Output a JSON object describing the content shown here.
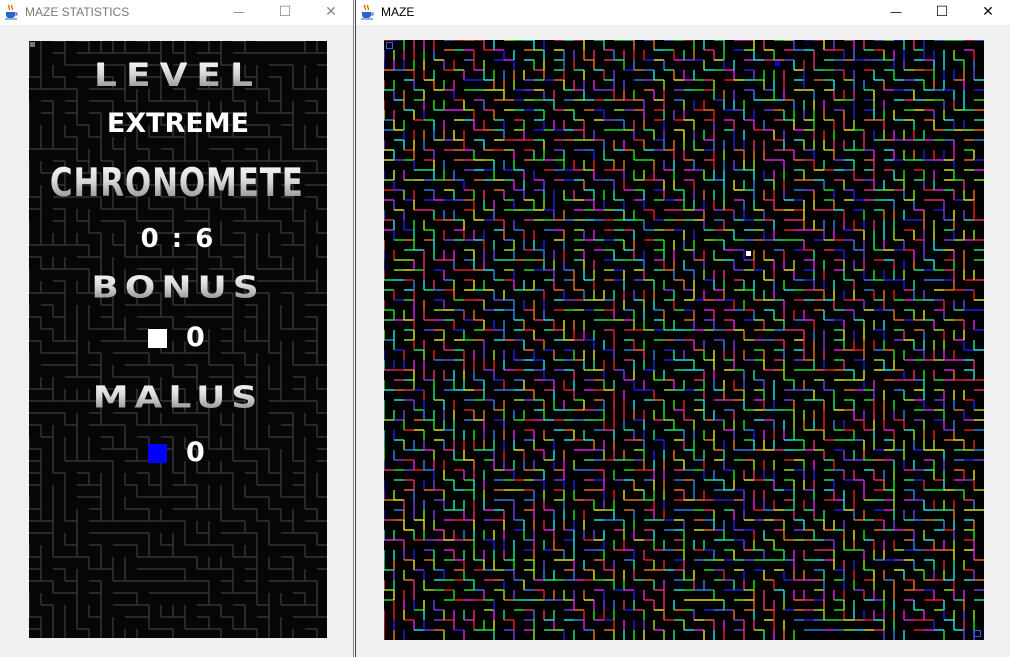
{
  "windows": [
    {
      "title": "MAZE STATISTICS",
      "controls": {
        "minimize": "—",
        "maximize": "☐",
        "close": "✕"
      }
    },
    {
      "title": "MAZE",
      "controls": {
        "minimize": "—",
        "maximize": "☐",
        "close": "✕"
      }
    }
  ],
  "stats": {
    "level_heading": "LEVEL",
    "level_value": "EXTREME",
    "chrono_heading": "CHRONOMETER",
    "chrono_value": "0 : 6",
    "bonus_heading": "BONUS",
    "bonus_count": "0",
    "malus_heading": "MALUS",
    "malus_count": "0"
  },
  "icons": {
    "app": "java-cup-icon",
    "bonus": "white-square-icon",
    "malus": "blue-square-icon"
  },
  "colors": {
    "bonus": "#ffffff",
    "malus": "#0000ff",
    "maze_background": "#000000",
    "stats_background": "#060606",
    "stats_maze_walls": "#3a3a3a",
    "maze_wall_palette": [
      "#ff2020",
      "#2020ff",
      "#20ff20",
      "#ff20ff",
      "#20ffff",
      "#ffff20",
      "#ff8020",
      "#8040ff",
      "#20ff90",
      "#ff3080",
      "#a0ff20",
      "#3090ff"
    ]
  }
}
